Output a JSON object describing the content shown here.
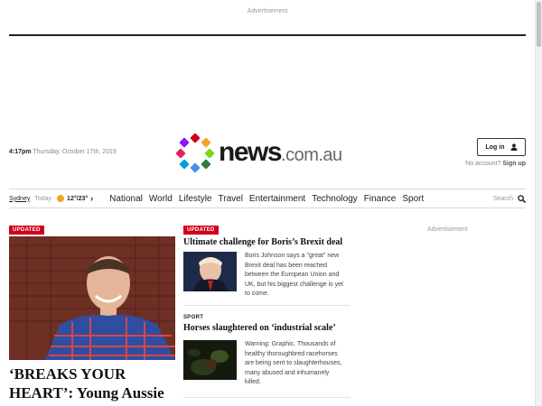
{
  "ads": {
    "top_label": "Advertisement",
    "side_label": "Advertisement"
  },
  "header": {
    "time": "4:17pm",
    "date": "Thursday, October 17th, 2019",
    "logo_main": "news",
    "logo_suffix": ".com.au",
    "login_label": "Log in",
    "no_account_text": "No account?",
    "signup_label": "Sign up"
  },
  "nav": {
    "city": "Sydney",
    "weather_day": "Today",
    "weather_temps": "12°/23°",
    "items": [
      "National",
      "World",
      "Lifestyle",
      "Travel",
      "Entertainment",
      "Technology",
      "Finance",
      "Sport"
    ],
    "search_label": "Search"
  },
  "hero": {
    "badge": "UPDATED",
    "headline": "‘BREAKS YOUR HEART’: Young Aussie dad"
  },
  "stories": [
    {
      "badge": "UPDATED",
      "title": "Ultimate challenge for Boris’s Brexit deal",
      "blurb": "Boris Johnson says a \"great\" new Brexit deal has been reached between the European Union and UK, but his biggest challenge is yet to come."
    },
    {
      "kicker": "SPORT",
      "title": "Horses slaughtered on ‘industrial scale’",
      "blurb": "Warning: Graphic. Thousands of healthy thoroughbred racehorses are being sent to slaughterhouses, many abused and inhumanely killed."
    }
  ],
  "colors": {
    "accent_red": "#d0021b",
    "logo_dots": [
      "#d0021b",
      "#f5a623",
      "#7ed321",
      "#4a90e2",
      "#9013fe",
      "#e91e63",
      "#00bcd4",
      "#f8a100"
    ]
  }
}
